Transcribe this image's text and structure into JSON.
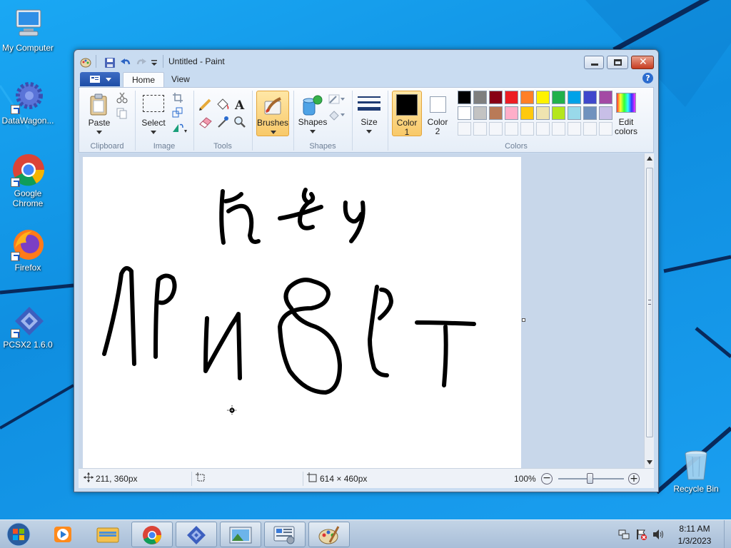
{
  "desktop": {
    "icons": [
      {
        "label": "My Computer"
      },
      {
        "label": "DataWagon..."
      },
      {
        "label": "Google Chrome"
      },
      {
        "label": "Firefox"
      },
      {
        "label": "PCSX2 1.6.0"
      },
      {
        "label": "Recycle Bin"
      }
    ]
  },
  "window": {
    "title": "Untitled - Paint",
    "tabs": [
      "Home",
      "View"
    ],
    "groups": {
      "clipboard": {
        "label": "Clipboard",
        "paste": "Paste"
      },
      "image": {
        "label": "Image",
        "select": "Select"
      },
      "tools": {
        "label": "Tools"
      },
      "brushes": {
        "label": "Brushes"
      },
      "shapes": {
        "label": "Shapes",
        "shapes_btn": "Shapes",
        "size": "Size"
      },
      "colors": {
        "label": "Colors",
        "color1_label_1": "Color",
        "color1_label_2": "1",
        "color2_label_1": "Color",
        "color2_label_2": "2",
        "edit_label_1": "Edit",
        "edit_label_2": "colors",
        "color1": "#000000",
        "color2": "#ffffff",
        "palette_row1": [
          "#000000",
          "#7f7f7f",
          "#880015",
          "#ed1c24",
          "#ff7f27",
          "#fff200",
          "#22b14c",
          "#00a2e8",
          "#3f48cc",
          "#a349a4"
        ],
        "palette_row2": [
          "#ffffff",
          "#c3c3c3",
          "#b97a57",
          "#ffaec9",
          "#ffc90e",
          "#efe4b0",
          "#b5e61d",
          "#99d9ea",
          "#7092be",
          "#c8bfe7"
        ]
      }
    },
    "status": {
      "cursor_pos": "211, 360px",
      "image_size": "614 × 460px",
      "zoom": "100%"
    }
  },
  "taskbar": {
    "time": "8:11 AM",
    "date": "1/3/2023"
  }
}
